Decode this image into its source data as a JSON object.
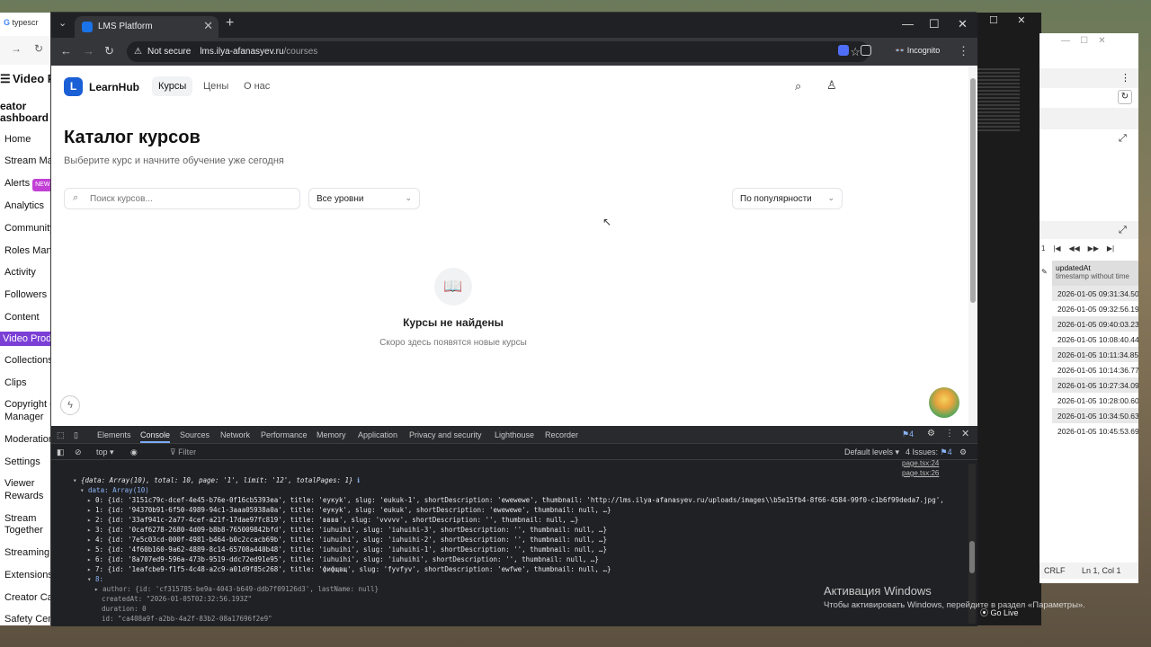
{
  "left_window": {
    "tab_title": "typescr",
    "header": "Video P",
    "subheader": "eator\nashboard",
    "menu": [
      {
        "label": "Home"
      },
      {
        "label": "Stream Ma"
      },
      {
        "label": "Alerts",
        "badge": "NEW"
      },
      {
        "label": "Analytics"
      },
      {
        "label": "Community"
      },
      {
        "label": "Roles Mana"
      },
      {
        "label": "Activity"
      },
      {
        "label": "Followers Li"
      },
      {
        "label": "Content"
      },
      {
        "label": "Video Produ",
        "active": true
      },
      {
        "label": "Collections"
      },
      {
        "label": "Clips"
      },
      {
        "label": "Copyright C"
      },
      {
        "label": "Manager"
      },
      {
        "label": "Moderation"
      },
      {
        "label": "Settings"
      },
      {
        "label": "Viewer"
      },
      {
        "label": "Rewards"
      },
      {
        "label": "Stream"
      },
      {
        "label": "Together"
      },
      {
        "label": "Streaming"
      },
      {
        "label": "Extensions"
      },
      {
        "label": "Creator Ca"
      },
      {
        "label": "Safety Cen"
      }
    ]
  },
  "browser": {
    "tab_title": "LMS Platform",
    "not_secure": "Not secure",
    "url_host": "lms.ilya-afanasyev.ru",
    "url_path": "/courses",
    "incognito": "Incognito"
  },
  "page": {
    "logo_letter": "L",
    "brand": "LearnHub",
    "nav": {
      "courses": "Курсы",
      "prices": "Цены",
      "about": "О нас"
    },
    "title": "Каталог курсов",
    "subtitle": "Выберите курс и начните обучение уже сегодня",
    "search_placeholder": "Поиск курсов...",
    "level_filter": "Все уровни",
    "sort": "По популярности",
    "empty_title": "Курсы не найдены",
    "empty_subtitle": "Скоро здесь появятся новые курсы"
  },
  "devtools": {
    "tabs": [
      "Elements",
      "Console",
      "Sources",
      "Network",
      "Performance",
      "Memory",
      "Application",
      "Privacy and security",
      "Lighthouse",
      "Recorder"
    ],
    "active_tab": "Console",
    "issue_badge": "4",
    "context": "top",
    "filter_placeholder": "Filter",
    "levels": "Default levels",
    "issues": "4 Issues:",
    "issues_count": "4",
    "source_links": [
      "page.tsx:24",
      "page.tsx:26"
    ],
    "lines": [
      "{data: Array(10), total: 10, page: '1', limit: '12', totalPages: 1}",
      "data: Array(10)",
      "0: {id: '3151c79c-dcef-4e45-b76e-0f16cb5393ea', title: 'eyкyk', slug: 'eukuk-1', shortDescription: 'ewewewe', thumbnail: 'http://lms.ilya-afanasyev.ru/uploads/images\\\\b5e15fb4-8f66-4584-99f0-c1b6f99deda7.jpg',",
      "1: {id: '94370b91-6f50-4989-94c1-3aaa05938a0a', title: 'eyкyk', slug: 'eukuk', shortDescription: 'ewewewe', thumbnail: null, …}",
      "2: {id: '33af941c-2a77-4cef-a21f-17dae97fc819', title: 'вввв', slug: 'vvvvv', shortDescription: '', thumbnail: null, …}",
      "3: {id: '0caf6278-2680-4d09-b8b8-765009842bfd', title: 'iuhuihi', slug: 'iuhuihi-3', shortDescription: '', thumbnail: null, …}",
      "4: {id: '7e5c03cd-000f-4981-b464-b0c2ccacb69b', title: 'iuhuihi', slug: 'iuhuihi-2', shortDescription: '', thumbnail: null, …}",
      "5: {id: '4f60b160-9a62-4889-8c14-65708a440b48', title: 'iuhuihi', slug: 'iuhuihi-1', shortDescription: '', thumbnail: null, …}",
      "6: {id: '8a707ed9-596a-473b-9519-ddc72ed91e95', title: 'iuhuihi', slug: 'iuhuihi', shortDescription: '', thumbnail: null, …}",
      "7: {id: '1eafcbe9-f1f5-4c48-a2c9-a01d9f85c268', title: 'фифщвщ', slug: 'fyvfyv', shortDescription: 'ewfwe', thumbnail: null, …}",
      "8:",
      "author: {id: 'cf315785-be9a-4043-b649-ddb7f09126d3', lastName: null}",
      "createdAt: \"2026-01-05T02:32:56.193Z\"",
      "duration: 0",
      "id: \"ca408a9f-a2bb-4a2f-83b2-08a17696f2e9\""
    ]
  },
  "right_window": {
    "column": "updatedAt",
    "column_type": "timestamp without time",
    "rows": [
      "2026-01-05 09:31:34.50",
      "2026-01-05 09:32:56.19",
      "2026-01-05 09:40:03.23",
      "2026-01-05 10:08:40.44",
      "2026-01-05 10:11:34.85",
      "2026-01-05 10:14:36.77",
      "2026-01-05 10:27:34.09",
      "2026-01-05 10:28:00.60",
      "2026-01-05 10:34:50.63",
      "2026-01-05 10:45:53.69"
    ],
    "status_crlf": "CRLF",
    "status_pos": "Ln 1, Col 1"
  },
  "windows_activation": {
    "title": "Активация Windows",
    "message": "Чтобы активировать Windows, перейдите в раздел «Параметры»."
  },
  "go_live": "Go Live"
}
